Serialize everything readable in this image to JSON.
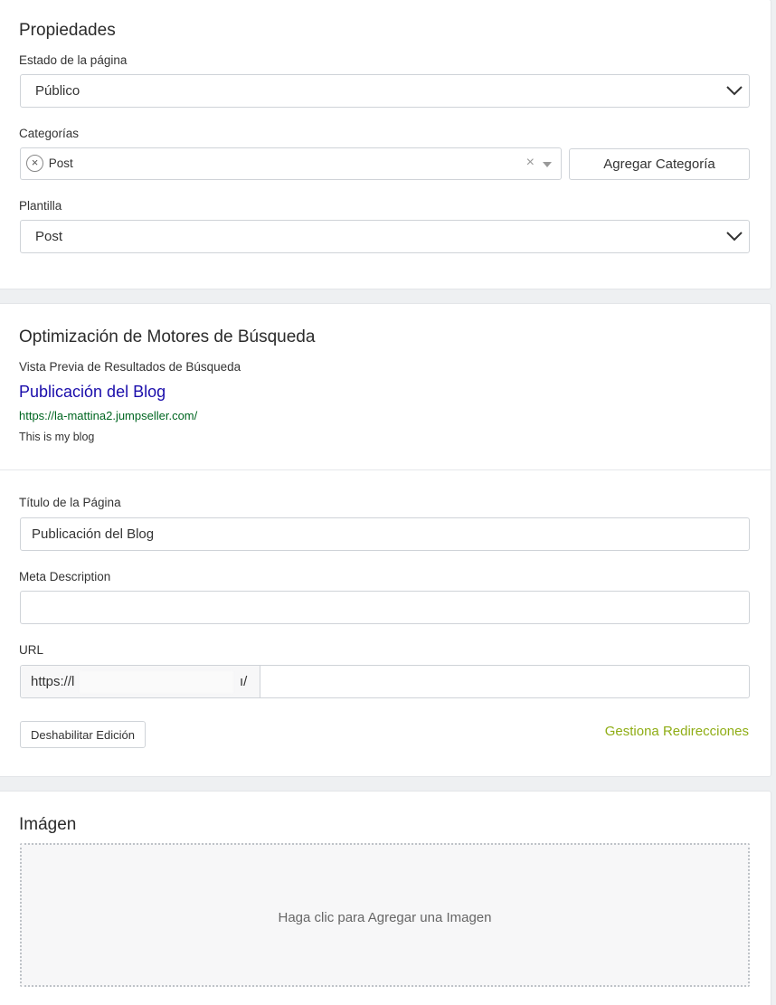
{
  "properties": {
    "title": "Propiedades",
    "page_state_label": "Estado de la página",
    "page_state_value": "Público",
    "categories_label": "Categorías",
    "category_tag": "Post",
    "clear_glyph": "×",
    "remove_glyph": "×",
    "add_category_button": "Agregar Categoría",
    "template_label": "Plantilla",
    "template_value": "Post"
  },
  "seo": {
    "title": "Optimización de Motores de Búsqueda",
    "preview_label": "Vista Previa de Resultados de Búsqueda",
    "preview_title": "Publicación del Blog",
    "preview_url": "https://la-mattina2.jumpseller.com/",
    "preview_description": "This is my blog",
    "page_title_label": "Título de la Página",
    "page_title_value": "Publicación del Blog",
    "meta_description_label": "Meta Description",
    "meta_description_value": "",
    "url_label": "URL",
    "url_prefix_start": "https://l",
    "url_prefix_end": "ı/",
    "url_slug_value": "",
    "disable_edit_button": "Deshabilitar Edición",
    "manage_redirects_link": "Gestiona Redirecciones"
  },
  "image": {
    "title": "Imágen",
    "dropzone_text": "Haga clic para Agregar una Imagen"
  },
  "colors": {
    "link_blue": "#1a0dab",
    "url_green": "#006621",
    "redirect_green": "#8fad15"
  }
}
